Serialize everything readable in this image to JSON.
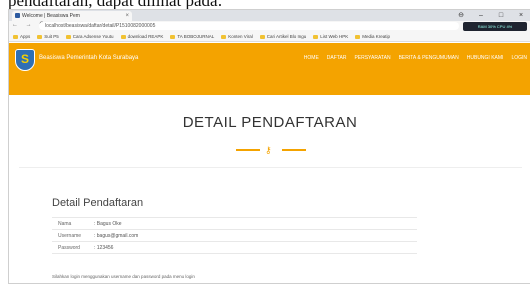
{
  "caption": {
    "text": "pendaftaran, dapat dilihat pada:"
  },
  "browser": {
    "tab_title": "Welcome | Beasiswa Pem",
    "tab_close": "×",
    "url": "localhost/beasiswa/daftar/detail/P1510082000005",
    "nav_icons": "← → C ⌂",
    "window_controls": [
      "⊖",
      "–",
      "□",
      "×"
    ],
    "system_tray": "RAM 30%  CPU 4%",
    "bookmarks": [
      "Apps",
      "Suit P5",
      "Cara Adsense Youtu",
      "download REAPK",
      "TA BOBOJURNAL",
      "Konten Viral",
      "Cari Artikel Blo Ingu",
      "List Web HPK",
      "Media Kreatip"
    ]
  },
  "header": {
    "logo_letter": "S",
    "brand": "Beasiswa Pemerintah Kota Surabaya",
    "menu": [
      "HOME",
      "DAFTAR",
      "PERSYARATAN",
      "BERITA & PENGUMUMAN",
      "HUBUNGI KAMI",
      "LOGIN"
    ]
  },
  "main": {
    "title": "DETAIL PENDAFTARAN",
    "ornament_icon": "key-icon",
    "ornament_glyph": "⚷",
    "card_title": "Detail Pendaftaran",
    "rows": [
      {
        "key": "Nama",
        "value": ": Bagus Oke"
      },
      {
        "key": "Username",
        "value": ": bagus@gmail.com"
      },
      {
        "key": "Password",
        "value": ": 123456"
      }
    ],
    "note": "Silahkan login menggunakan username dan password pada menu login"
  },
  "colors": {
    "accent": "#f4a300",
    "logo_blue": "#2e6fb5"
  }
}
